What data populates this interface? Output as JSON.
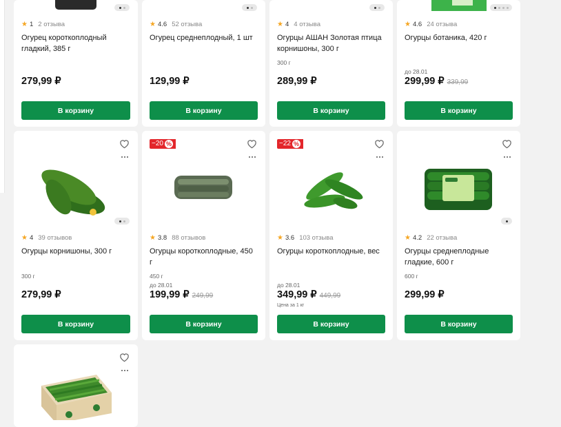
{
  "colors": {
    "accent": "#0e8f4a",
    "discount": "#e3262b",
    "star": "#f5a623"
  },
  "cards": [
    {
      "rating": "1",
      "reviews": "2 отзыва",
      "title": "Огурец короткоплодный гладкий, 385 г",
      "price": "279,99 ₽",
      "button": "В корзину"
    },
    {
      "rating": "4.6",
      "reviews": "52 отзыва",
      "title": "Огурец среднеплодный, 1 шт",
      "price": "129,99 ₽",
      "button": "В корзину"
    },
    {
      "rating": "4",
      "reviews": "4 отзыва",
      "title": "Огурцы АШАН Золотая птица корнишоны, 300 г",
      "weight": "300 г",
      "price": "289,99 ₽",
      "button": "В корзину"
    },
    {
      "rating": "4.6",
      "reviews": "24 отзыва",
      "title": "Огурцы ботаника, 420 г",
      "until": "до 28.01",
      "price": "299,99 ₽",
      "old_price": "339,99",
      "button": "В корзину"
    },
    {
      "rating": "4",
      "reviews": "39 отзывов",
      "title": "Огурцы корнишоны, 300 г",
      "weight": "300 г",
      "price": "279,99 ₽",
      "button": "В корзину"
    },
    {
      "discount": "−20",
      "rating": "3.8",
      "reviews": "88 отзывов",
      "title": "Огурцы короткоплодные, 450 г",
      "weight": "450 г",
      "until": "до 28.01",
      "price": "199,99 ₽",
      "old_price": "249,99",
      "button": "В корзину"
    },
    {
      "discount": "−22",
      "rating": "3.6",
      "reviews": "103 отзыва",
      "title": "Огурцы короткоплодные, вес",
      "until": "до 28.01",
      "price": "349,99 ₽",
      "old_price": "449,99",
      "unit_note": "Цена за 1 кг",
      "button": "В корзину"
    },
    {
      "rating": "4.2",
      "reviews": "22 отзыва",
      "title": "Огурцы среднеплодные гладкие, 600 г",
      "weight": "600 г",
      "price": "299,99 ₽",
      "button": "В корзину"
    }
  ],
  "icons": {
    "favorite": "heart-icon",
    "more": "more-dots-icon",
    "discount": "percent-icon",
    "rating": "star-icon"
  }
}
